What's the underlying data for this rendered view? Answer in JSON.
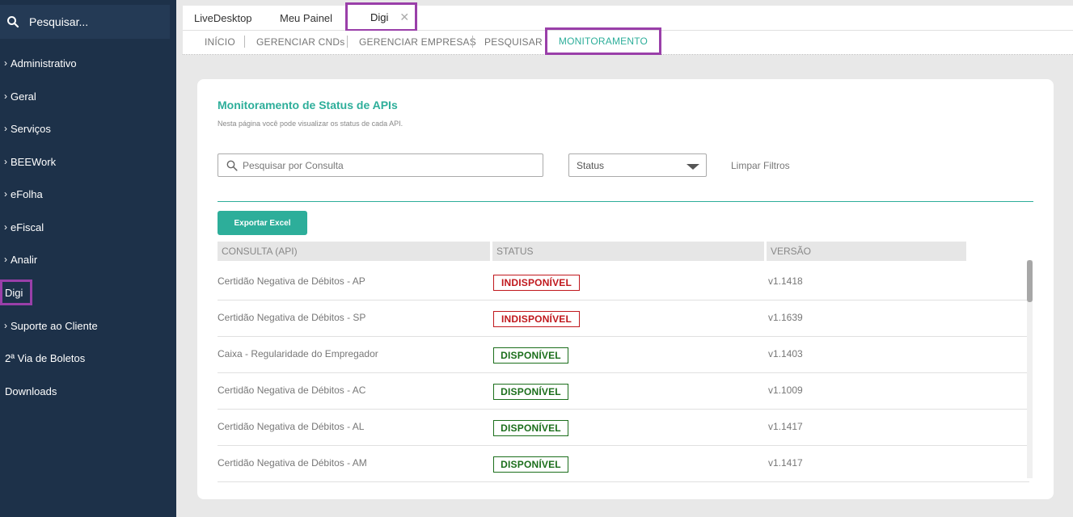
{
  "sidebar": {
    "search_label": "Pesquisar...",
    "items": [
      {
        "label": "Administrativo",
        "chevron": true
      },
      {
        "label": "Geral",
        "chevron": true
      },
      {
        "label": "Serviços",
        "chevron": true
      },
      {
        "label": "BEEWork",
        "chevron": true
      },
      {
        "label": "eFolha",
        "chevron": true
      },
      {
        "label": "eFiscal",
        "chevron": true
      },
      {
        "label": "Analir",
        "chevron": true
      },
      {
        "label": "Digi",
        "chevron": false
      },
      {
        "label": "Suporte ao Cliente",
        "chevron": true
      },
      {
        "label": "2ª Via de Boletos",
        "chevron": false
      },
      {
        "label": "Downloads",
        "chevron": false
      }
    ]
  },
  "tabs": {
    "items": [
      "LiveDesktop",
      "Meu Painel",
      "Digi"
    ],
    "close_glyph": "✕"
  },
  "subnav": {
    "items": [
      "INÍCIO",
      "GERENCIAR CNDs",
      "GERENCIAR EMPRESAS",
      "PESQUISAR",
      "MONITORAMENTO"
    ]
  },
  "main": {
    "title": "Monitoramento de Status de APIs",
    "subtitle": "Nesta página você pode visualizar os status de cada API.",
    "search_placeholder": "Pesquisar por Consulta",
    "status_select": "Status",
    "clear_filters": "Limpar Filtros",
    "export_button": "Exportar Excel",
    "columns": [
      "CONSULTA (API)",
      "STATUS",
      "VERSÃO"
    ],
    "rows": [
      {
        "name": "Certidão Negativa de Débitos - AP",
        "status": "INDISPONÍVEL",
        "version": "v1.1418"
      },
      {
        "name": "Certidão Negativa de Débitos - SP",
        "status": "INDISPONÍVEL",
        "version": "v1.1639"
      },
      {
        "name": "Caixa - Regularidade do Empregador",
        "status": "DISPONÍVEL",
        "version": "v1.1403"
      },
      {
        "name": "Certidão Negativa de Débitos - AC",
        "status": "DISPONÍVEL",
        "version": "v1.1009"
      },
      {
        "name": "Certidão Negativa de Débitos - AL",
        "status": "DISPONÍVEL",
        "version": "v1.1417"
      },
      {
        "name": "Certidão Negativa de Débitos - AM",
        "status": "DISPONÍVEL",
        "version": "v1.1417"
      }
    ]
  },
  "colors": {
    "sidebar_bg": "#1d3149",
    "accent": "#2dae9a",
    "highlight": "#9a3fa9",
    "status_down": "#c0181d",
    "status_up": "#1b6e1b"
  }
}
